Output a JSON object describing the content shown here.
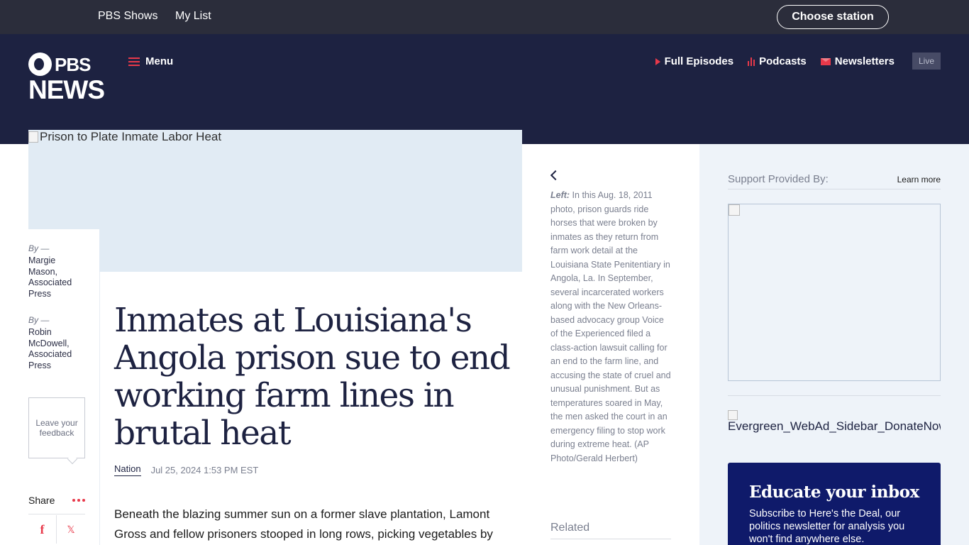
{
  "topbar": {
    "links": [
      "PBS Shows",
      "My List"
    ],
    "choose_station": "Choose station"
  },
  "header": {
    "logo_top": "PBS",
    "logo_bottom": "NEWS",
    "menu_label": "Menu",
    "nav": [
      {
        "label": "Full Episodes",
        "icon": "play-icon"
      },
      {
        "label": "Podcasts",
        "icon": "podcast-icon"
      },
      {
        "label": "Newsletters",
        "icon": "mail-icon"
      }
    ],
    "live_label": "Live"
  },
  "hero": {
    "alt_text": "Prison to Plate Inmate Labor Heat"
  },
  "byline": {
    "by_label": "By —",
    "authors": [
      {
        "name": "Margie Mason, Associated Press"
      },
      {
        "name": "Robin McDowell, Associated Press"
      }
    ],
    "feedback_label": "Leave your feedback",
    "share_label": "Share"
  },
  "article": {
    "headline": "Inmates at Louisiana's Angola prison sue to end working farm lines in brutal heat",
    "section": "Nation",
    "date": "Jul 25, 2024 1:53 PM EST",
    "body_start": "Beneath the blazing summer sun on a former slave plantation, Lamont Gross and fellow prisoners stooped in long rows, picking vegetables by"
  },
  "caption": {
    "label": "Left:",
    "text": " In this Aug. 18, 2011 photo, prison guards ride horses that were broken by inmates as they return from farm work detail at the Louisiana State Penitentiary in Angola, La. In September, several incarcerated workers along with the New Orleans-based advocacy group Voice of the Experienced filed a class-action lawsuit calling for an end to the farm line, and accusing the state of cruel and unusual punishment. But as temperatures soared in May, the men asked the court in an emergency filing to stop work during extreme heat. (AP Photo/Gerald Herbert)",
    "related_label": "Related"
  },
  "sidebar": {
    "support_label": "Support Provided By:",
    "learn_more": "Learn more",
    "evergreen_alt": "Evergreen_WebAd_Sidebar_DonateNow",
    "inbox_title": "Educate your inbox",
    "inbox_text": "Subscribe to Here's the Deal, our politics newsletter for analysis you won't find anywhere else."
  },
  "colors": {
    "header_bg": "#1d2241",
    "topbar_bg": "#2b2d3b",
    "accent_red": "#e8394a",
    "inbox_bg": "#0f1a6a",
    "sidebar_bg": "#eef3f9"
  }
}
